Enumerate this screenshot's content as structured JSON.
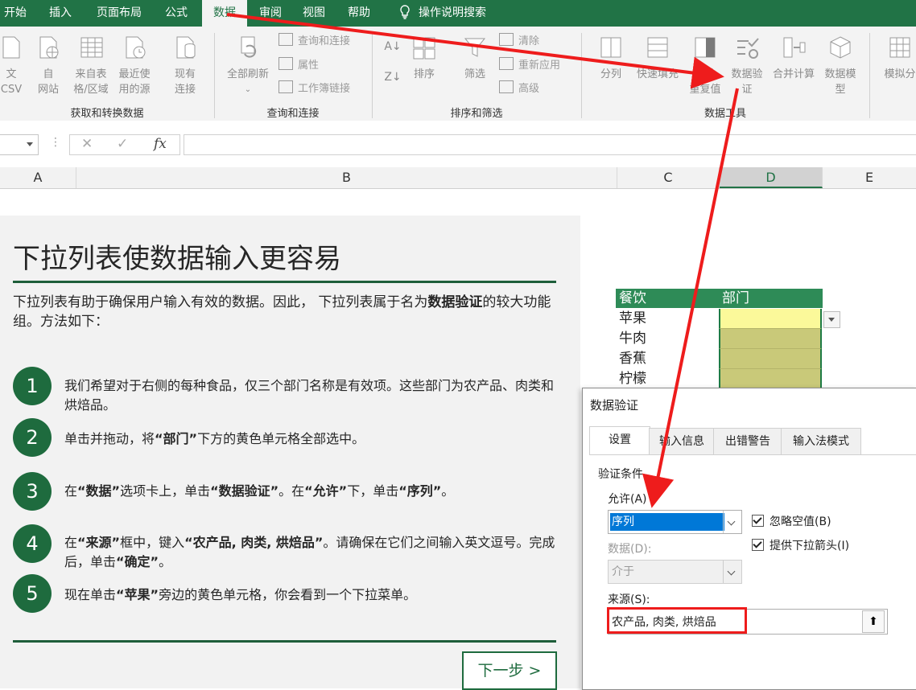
{
  "tabs": [
    {
      "label": "开始",
      "active": false
    },
    {
      "label": "插入",
      "active": false
    },
    {
      "label": "页面布局",
      "active": false
    },
    {
      "label": "公式",
      "active": false
    },
    {
      "label": "数据",
      "active": true
    },
    {
      "label": "审阅",
      "active": false
    },
    {
      "label": "视图",
      "active": false
    },
    {
      "label": "帮助",
      "active": false
    }
  ],
  "tell_me": "操作说明搜索",
  "ribbon": {
    "get_transform": {
      "from_text_csv": "文\nCSV",
      "from_web": "自\n网站",
      "from_table": "来自表\n格/区域",
      "recent_sources": "最近使\n用的源",
      "existing_conn": "现有\n连接",
      "label": "获取和转换数据"
    },
    "queries": {
      "refresh_all": "全部刷新",
      "queries_conn": "查询和连接",
      "properties": "属性",
      "edit_links": "工作簿链接",
      "label": "查询和连接"
    },
    "sort_filter": {
      "sort": "排序",
      "filter": "筛选",
      "clear": "清除",
      "reapply": "重新应用",
      "advanced": "高级",
      "label": "排序和筛选"
    },
    "data_tools": {
      "split": "分列",
      "flash_fill": "快速填充",
      "remove_dup": "删除\n重复值",
      "validation": "数据验\n证",
      "consolidate": "合并计算",
      "data_model": "数据模\n型",
      "label": "数据工具"
    },
    "forecast": {
      "what_if": "模拟分"
    }
  },
  "formula_bar": {
    "cancel": "✕",
    "enter": "✓",
    "fx": "fx"
  },
  "columns": [
    "A",
    "B",
    "C",
    "D",
    "E"
  ],
  "panel": {
    "title": "下拉列表使数据输入更容易",
    "intro_1": "下拉列表有助于确保用户输入有效的数据。因此，  下拉列表属于名为",
    "intro_bold": "数据验证",
    "intro_2": "的较大功能组。方法如下：",
    "steps": [
      {
        "num": "1",
        "text": "我们希望对于右侧的每种食品，仅三个部门名称是有效项。这些部门为农产品、肉类和烘焙品。"
      },
      {
        "num": "2",
        "a": "单击并拖动，将",
        "b": "“部门”",
        "c": "下方的黄色单元格全部选中。"
      },
      {
        "num": "3",
        "a": "在",
        "b": "“数据”",
        "c": "选项卡上，单击",
        "d": "“数据验证”",
        "e": "。在",
        "f": "“允许”",
        "g": "下，单击",
        "h": "“序列”",
        "i": "。"
      },
      {
        "num": "4",
        "a": "在",
        "b": "“来源”",
        "c": "框中，键入",
        "d": "“农产品, 肉类, 烘焙品”",
        "e": "。请确保在它们之间输入英文逗号。完成后，单击",
        "f": "“确定”",
        "g": "。"
      },
      {
        "num": "5",
        "a": "现在单击",
        "b": "“苹果”",
        "c": "旁边的黄色单元格，你会看到一个下拉菜单。"
      }
    ],
    "next": "下一步 >"
  },
  "table": {
    "header_food": "餐饮",
    "header_dept": "部门",
    "foods": [
      "苹果",
      "牛肉",
      "香蕉",
      "柠檬"
    ]
  },
  "dialog": {
    "title": "数据验证",
    "tabs": [
      "设置",
      "输入信息",
      "出错警告",
      "输入法模式"
    ],
    "criteria_label": "验证条件",
    "allow_label": "允许(A)",
    "allow_value": "序列",
    "data_label": "数据(D):",
    "data_value": "介于",
    "ignore_blank": "忽略空值(B)",
    "in_cell_dropdown": "提供下拉箭头(I)",
    "source_label": "来源(S):",
    "source_value": "农产品, 肉类, 烘焙品"
  },
  "colors": {
    "excel_green": "#217346",
    "header_green": "#2e8b57",
    "yellow_cell": "#c9c979",
    "active_yellow": "#fbf99a",
    "annotation_red": "#ee1c1c",
    "selection_blue": "#0078d7"
  }
}
